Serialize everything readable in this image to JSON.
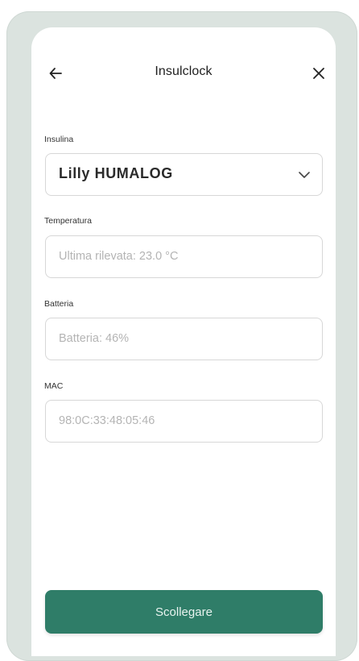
{
  "header": {
    "title": "Insulclock",
    "back_icon": "arrow-left-icon",
    "close_icon": "close-icon"
  },
  "form": {
    "insulin": {
      "label": "Insulina",
      "value": "Lilly HUMALOG",
      "icon": "chevron-down-icon"
    },
    "temperature": {
      "label": "Temperatura",
      "value": "Ultima rilevata: 23.0 °C"
    },
    "battery": {
      "label": "Batteria",
      "value": "Batteria: 46%"
    },
    "mac": {
      "label": "MAC",
      "value": "98:0C:33:48:05:46"
    }
  },
  "actions": {
    "disconnect_label": "Scollegare"
  },
  "colors": {
    "primary": "#2f7d68",
    "frame": "#dbe3df"
  }
}
